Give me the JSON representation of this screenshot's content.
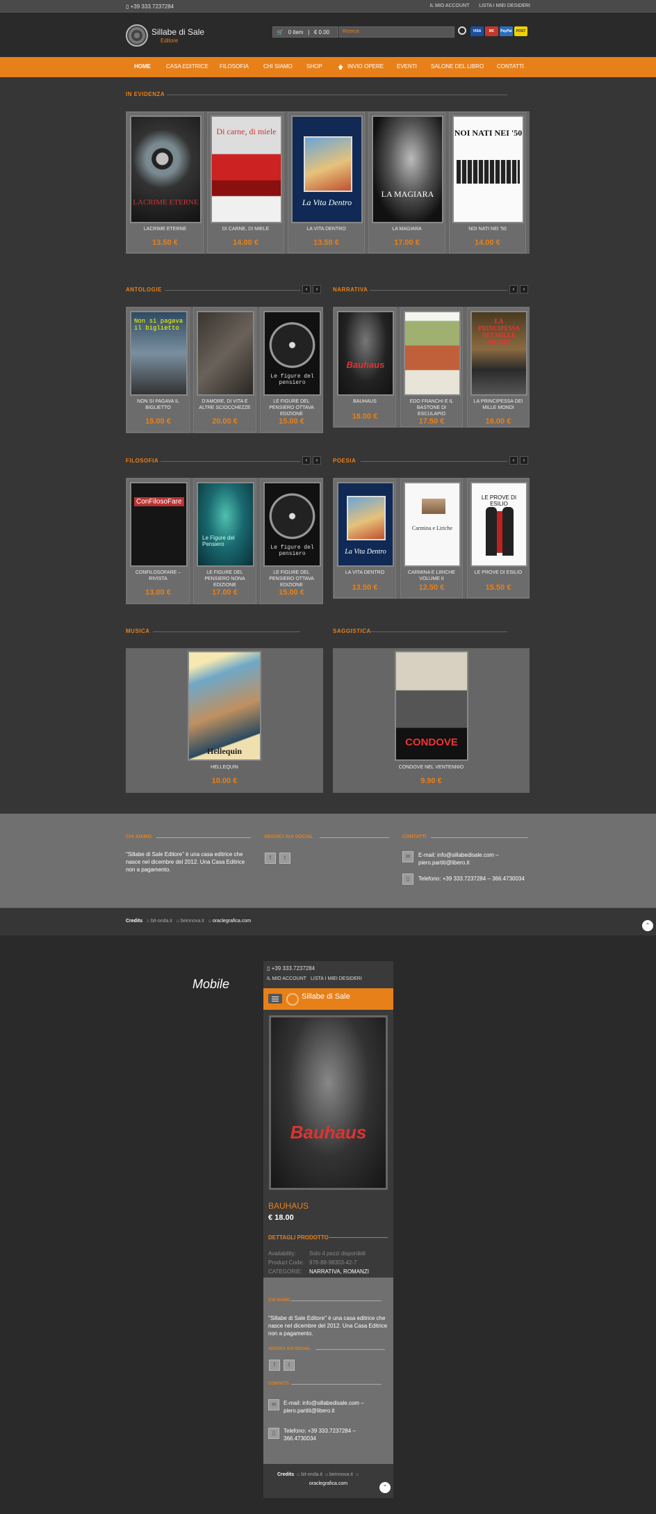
{
  "topbar": {
    "phone": "▯ +39 333.7237284",
    "account": "IL MIO ACCOUNT",
    "wishlist": "LISTA I MIEI DESIDERI"
  },
  "logo": {
    "name": "Sillabe di Sale",
    "sub": "Editore"
  },
  "cart": {
    "items": "0 item",
    "sep": "|",
    "total": "€ 0.00"
  },
  "search": {
    "placeholder": "Ricerca"
  },
  "cards": [
    "VISA",
    "MC",
    "PayPal",
    "POST"
  ],
  "nav": [
    "HOME",
    "CASA EDITRICE",
    "FILOSOFIA",
    "CHI SIAMO",
    "SHOP",
    "INVIO OPERE",
    "EVENTI",
    "SALONE DEL LIBRO",
    "CONTATTI"
  ],
  "featured": {
    "title": "IN EVIDENZA",
    "items": [
      {
        "title": "LACRIME ETERNE",
        "price": "13.50 €"
      },
      {
        "title": "DI CARNE, DI MIELE",
        "price": "14.00 €"
      },
      {
        "title": "LA VITA DENTRO",
        "price": "13.50 €"
      },
      {
        "title": "LA MAGIARA",
        "price": "17.00 €"
      },
      {
        "title": "NOI NATI NEI '50",
        "price": "14.00 €"
      }
    ]
  },
  "sections": [
    {
      "title": "ANTOLOGIE",
      "items": [
        {
          "title": "NON SI PAGAVA IL BIGLIETTO",
          "price": "15.00 €"
        },
        {
          "title": "D'AMORE, DI VITA E ALTRE SCIOCCHEZZE",
          "price": "20.00 €"
        },
        {
          "title": "LE FIGURE DEL PENSIERO OTTAVA EDIZIONE",
          "price": "15.00 €"
        }
      ]
    },
    {
      "title": "NARRATIVA",
      "items": [
        {
          "title": "BAUHAUS",
          "price": "18.00 €"
        },
        {
          "title": "EDO FRANCHI E IL BASTONE DI ESCULAPIO",
          "price": "17.50 €"
        },
        {
          "title": "LA PRINCIPESSA DEI MILLE MONDI",
          "price": "16.00 €"
        }
      ]
    },
    {
      "title": "FILOSOFIA",
      "items": [
        {
          "title": "CONFILOSOFARE – RIVISTA",
          "price": "13.00 €"
        },
        {
          "title": "LE FIGURE DEL PENSIERO NONA EDIZIONE",
          "price": "17.00 €"
        },
        {
          "title": "LE FIGURE DEL PENSIERO OTTAVA EDIZIONE",
          "price": "15.00 €"
        }
      ]
    },
    {
      "title": "POESIA",
      "items": [
        {
          "title": "LA VITA DENTRO",
          "price": "13.50 €"
        },
        {
          "title": "CARMINA E LIRICHE VOLUME II",
          "price": "12.50 €"
        },
        {
          "title": "LE PROVE DI ESILIO",
          "price": "15.50 €"
        }
      ]
    },
    {
      "title": "MUSICA",
      "items": [
        {
          "title": "HELLEQUIN",
          "price": "10.00 €"
        }
      ]
    },
    {
      "title": "SAGGISTICA",
      "items": [
        {
          "title": "CONDOVE NEL VENTENNIO",
          "price": "9.90 €"
        }
      ]
    }
  ],
  "cover_text": {
    "c0": "LACRIME ETERNE",
    "c1": "Di carne, di miele",
    "c2": "La Vita Dentro",
    "c3": "LA MAGIARA",
    "c4": "NOI NATI NEI '50",
    "b1": "Non si pagava il biglietto",
    "b3": "Le figure del pensiero",
    "b4": "Bauhaus",
    "b6": "LA PRINCIPESSA DEI MILLE MONDI",
    "b7": "ConFilosoFare",
    "b8": "Le Figure del Pensiero",
    "b10": "Carmina e Liriche",
    "b11": "LE PROVE DI ESILIO",
    "b12": "Hellequin",
    "b13": "CONDOVE"
  },
  "footer": {
    "about_title": "CHI SIAMO",
    "about_text": "\"Sillabe di Sale Editore\" è una casa editrice che nasce nel dicembre del 2012. Una Casa Editrice non a pagamento.",
    "social_title": "SEGUICI SUI SOCIAL",
    "contact_title": "CONTATTI",
    "email": "E-mail: info@sillabedisale.com – piero.partiti@libero.it",
    "phone": "Telefono: +39 333.7237284 – 366.4730034"
  },
  "credits": {
    "label": "Credits",
    "c1": "bit-onda.it",
    "c2": "beinnova.it",
    "c3": "oraclegrafica.com"
  },
  "mobile": {
    "label": "Mobile",
    "phone": "▯ +39 333.7237284",
    "account": "IL MIO ACCOUNT",
    "wishlist": "LISTA I MIEI DESIDERI",
    "brand": "Sillabe di Sale",
    "product": "BAUHAUS",
    "price": "€ 18.00",
    "details_title": "DETTAGLI PRODOTTO",
    "availability_label": "Availability:",
    "availability": "Solo 4 pezzi disponibili",
    "code_label": "Product Code:",
    "code": "978-88-98303-42-7",
    "cat_label": "CATEGORIE:",
    "cats": "NARRATIVA, ROMANZI",
    "about_title": "CHI SIAMO",
    "about_text": "\"Sillabe di Sale Editore\" è una casa editrice che nasce nel dicembre del 2012. Una Casa Editrice non a pagamento.",
    "social_title": "SEGUICI SUI SOCIAL",
    "contact_title": "CONTATTI",
    "email": "E-mail: info@sillabedisale.com – piero.partiti@libero.it",
    "phone2": "Telefono: +39 333.7237284 – 366.4730034",
    "credits": "Credits",
    "c1": "bit-onda.it",
    "c2": "beinnova.it",
    "c3": "oraclegrafica.com",
    "cover_title": "Bauhaus"
  },
  "colors": {
    "accent": "#e8801a",
    "bg": "#363636",
    "panel": "#666666"
  }
}
